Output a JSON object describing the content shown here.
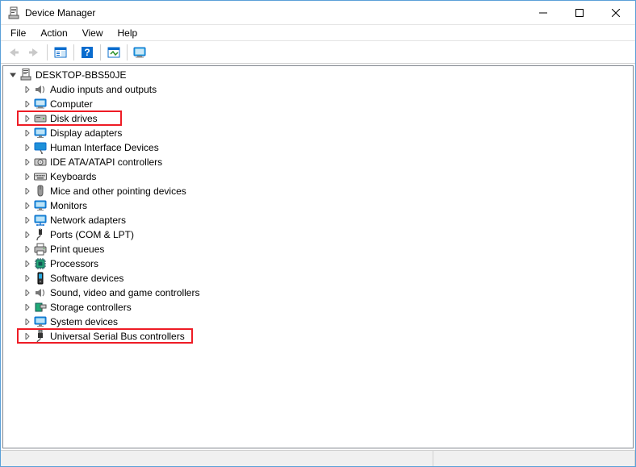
{
  "window": {
    "title": "Device Manager"
  },
  "menu": {
    "file": "File",
    "action": "Action",
    "view": "View",
    "help": "Help"
  },
  "tree": {
    "root": "DESKTOP-BBS50JE",
    "items": [
      {
        "label": "Audio inputs and outputs",
        "icon": "audio"
      },
      {
        "label": "Computer",
        "icon": "computer"
      },
      {
        "label": "Disk drives",
        "icon": "disk",
        "highlight": true
      },
      {
        "label": "Display adapters",
        "icon": "display"
      },
      {
        "label": "Human Interface Devices",
        "icon": "hid"
      },
      {
        "label": "IDE ATA/ATAPI controllers",
        "icon": "ide"
      },
      {
        "label": "Keyboards",
        "icon": "keyboard"
      },
      {
        "label": "Mice and other pointing devices",
        "icon": "mouse"
      },
      {
        "label": "Monitors",
        "icon": "monitor"
      },
      {
        "label": "Network adapters",
        "icon": "network"
      },
      {
        "label": "Ports (COM & LPT)",
        "icon": "port"
      },
      {
        "label": "Print queues",
        "icon": "printer"
      },
      {
        "label": "Processors",
        "icon": "cpu"
      },
      {
        "label": "Software devices",
        "icon": "software"
      },
      {
        "label": "Sound, video and game controllers",
        "icon": "sound"
      },
      {
        "label": "Storage controllers",
        "icon": "storage"
      },
      {
        "label": "System devices",
        "icon": "system"
      },
      {
        "label": "Universal Serial Bus controllers",
        "icon": "usb",
        "highlight": true
      }
    ]
  }
}
